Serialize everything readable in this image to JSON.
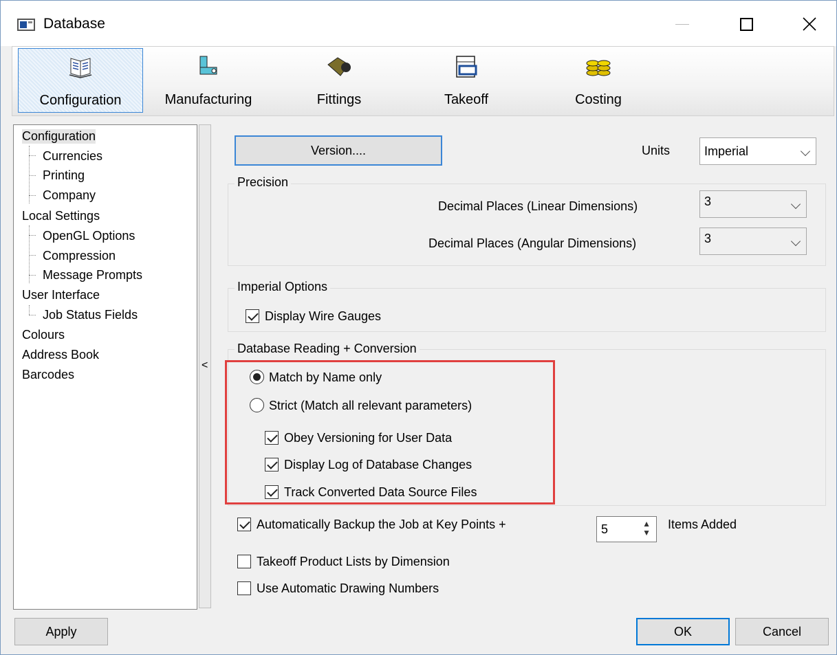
{
  "window": {
    "title": "Database"
  },
  "toolbar": {
    "items": [
      {
        "label": "Configuration",
        "icon": "book-icon"
      },
      {
        "label": "Manufacturing",
        "icon": "pipe-icon"
      },
      {
        "label": "Fittings",
        "icon": "fitting-icon"
      },
      {
        "label": "Takeoff",
        "icon": "takeoff-icon"
      },
      {
        "label": "Costing",
        "icon": "coins-icon"
      }
    ]
  },
  "tree": {
    "items": [
      {
        "label": "Configuration",
        "level": 0
      },
      {
        "label": "Currencies",
        "level": 1
      },
      {
        "label": "Printing",
        "level": 1
      },
      {
        "label": "Company",
        "level": 1
      },
      {
        "label": "Local Settings",
        "level": 0
      },
      {
        "label": "OpenGL Options",
        "level": 1
      },
      {
        "label": "Compression",
        "level": 1
      },
      {
        "label": "Message Prompts",
        "level": 1
      },
      {
        "label": "User Interface",
        "level": 0
      },
      {
        "label": "Job Status Fields",
        "level": 1
      },
      {
        "label": "Colours",
        "level": 0
      },
      {
        "label": "Address Book",
        "level": 0
      },
      {
        "label": "Barcodes",
        "level": 0
      }
    ]
  },
  "splitter": {
    "arrow": "<"
  },
  "config": {
    "version_button": "Version....",
    "units_label": "Units",
    "units_value": "Imperial",
    "precision": {
      "title": "Precision",
      "linear_label": "Decimal Places (Linear Dimensions)",
      "linear_value": "3",
      "angular_label": "Decimal Places (Angular Dimensions)",
      "angular_value": "3"
    },
    "imperial": {
      "title": "Imperial Options",
      "wire_gauges_label": "Display Wire Gauges",
      "wire_gauges_checked": true
    },
    "db_reading": {
      "title": "Database Reading + Conversion",
      "match_name_label": "Match by Name only",
      "match_name_selected": true,
      "strict_label": "Strict (Match all relevant parameters)",
      "strict_selected": false,
      "obey_versioning_label": "Obey Versioning for User Data",
      "display_log_label": "Display Log of Database Changes",
      "track_converted_label": "Track Converted Data Source Files"
    },
    "auto_backup_label": "Automatically Backup the Job at Key Points +",
    "auto_backup_checked": true,
    "items_added_value": "5",
    "items_added_label": "Items Added",
    "takeoff_lists_label": "Takeoff Product Lists by Dimension",
    "takeoff_lists_checked": false,
    "auto_drawing_label": "Use Automatic Drawing Numbers",
    "auto_drawing_checked": false
  },
  "footer": {
    "apply": "Apply",
    "ok": "OK",
    "cancel": "Cancel"
  },
  "colors": {
    "accent": "#3b86d6",
    "highlight_box": "#e0403f"
  }
}
